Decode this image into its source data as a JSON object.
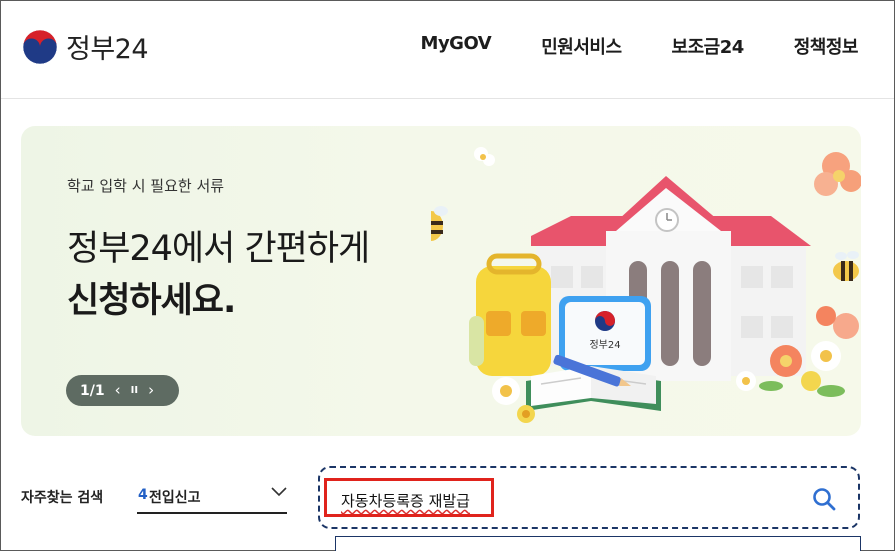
{
  "header": {
    "logo_text": "정부24",
    "nav": [
      "MyGOV",
      "민원서비스",
      "보조금24",
      "정책정보"
    ]
  },
  "banner": {
    "subtitle": "학교 입학 시 필요한 서류",
    "title_line1": "정부24에서 간편하게",
    "title_line2": "신청하세요.",
    "pager_count": "1/1",
    "prev_symbol": "‹",
    "pause_symbol": "II",
    "next_symbol": "›",
    "tablet_label": "정부24"
  },
  "search": {
    "faq_label": "자주찾는 검색",
    "faq_rank": "4",
    "faq_value": "전입신고",
    "query": "자동차등록증 재발급"
  },
  "colors": {
    "accent_blue": "#2360c5",
    "highlight_red": "#e0231c",
    "search_border": "#1b3566"
  }
}
